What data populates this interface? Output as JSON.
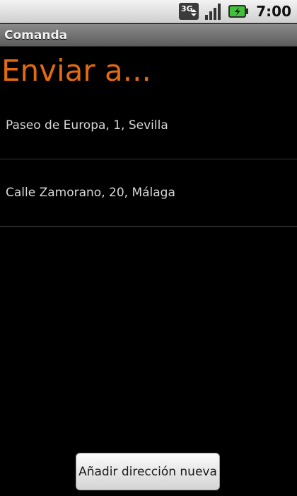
{
  "status_bar": {
    "network_label": "3G",
    "time": "7:00",
    "icons": [
      "3g-data-icon",
      "signal-strength-icon",
      "battery-charging-icon"
    ]
  },
  "title_bar": {
    "title": "Comanda"
  },
  "header": {
    "title": "Enviar a..."
  },
  "addresses": [
    {
      "label": "Paseo de Europa, 1, Sevilla"
    },
    {
      "label": "Calle Zamorano, 20, Málaga"
    }
  ],
  "actions": {
    "add_address_label": "Añadir dirección nueva"
  },
  "colors": {
    "accent": "#e36a10",
    "background": "#000000",
    "list_text": "#d8d8d8"
  }
}
